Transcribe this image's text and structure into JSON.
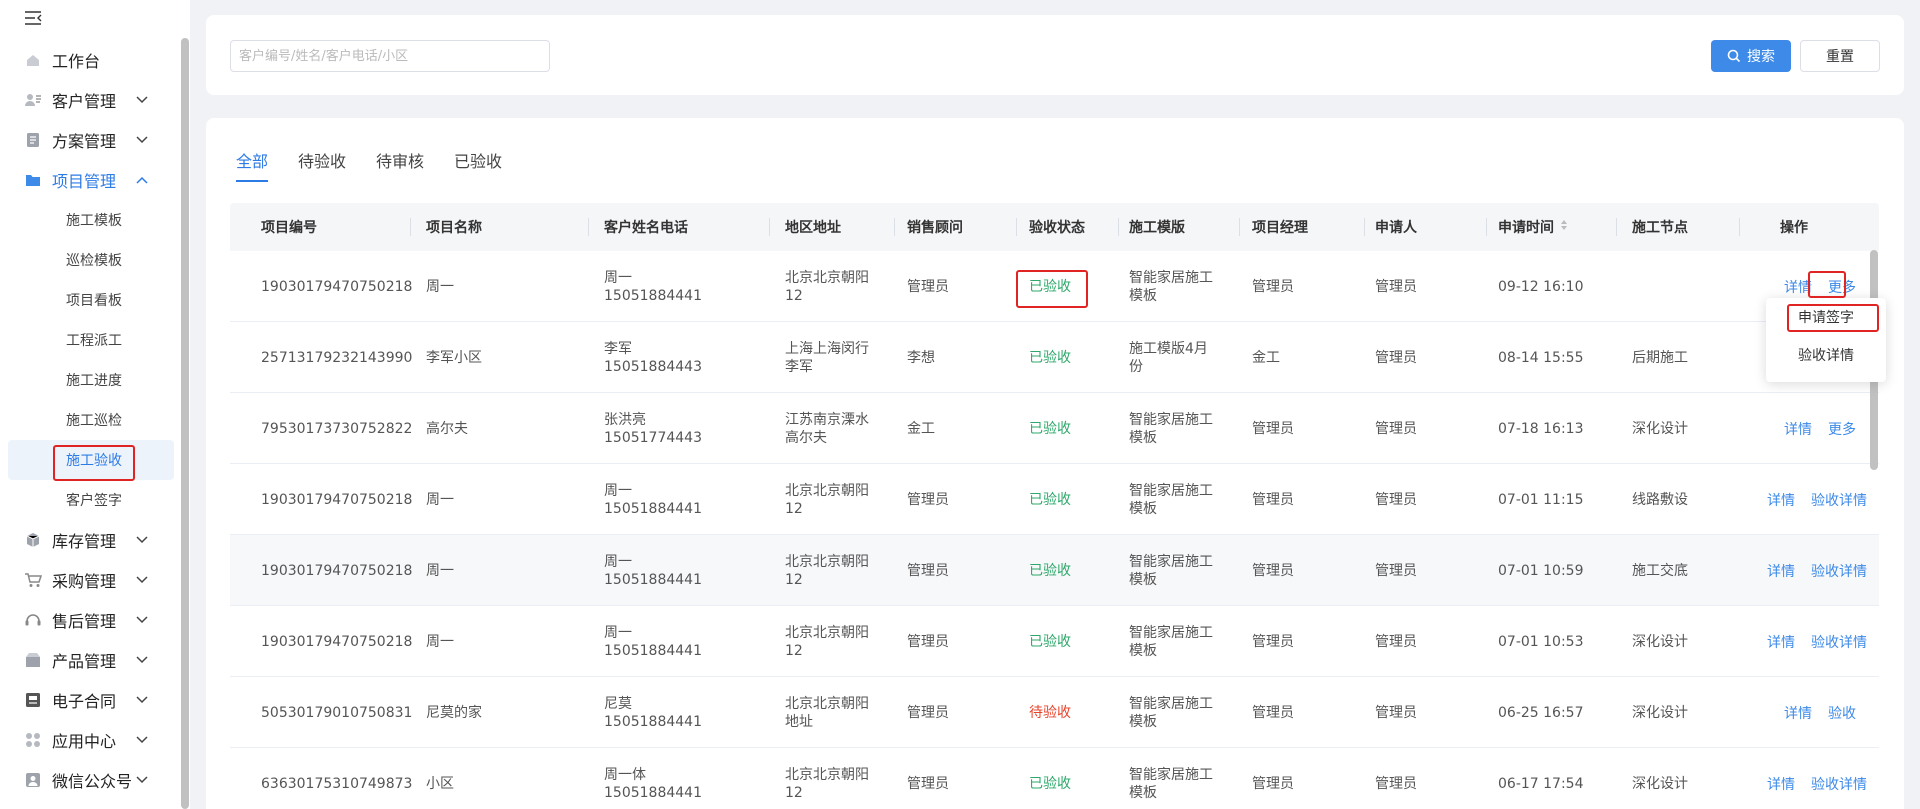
{
  "sidebar": {
    "items": [
      {
        "label": "工作台",
        "icon": "home-icon"
      },
      {
        "label": "客户管理",
        "icon": "customer-icon"
      },
      {
        "label": "方案管理",
        "icon": "plan-icon"
      },
      {
        "label": "项目管理",
        "icon": "folder-icon",
        "open": true
      },
      {
        "label": "库存管理",
        "icon": "inventory-icon"
      },
      {
        "label": "采购管理",
        "icon": "cart-icon"
      },
      {
        "label": "售后管理",
        "icon": "headset-icon"
      },
      {
        "label": "产品管理",
        "icon": "product-icon"
      },
      {
        "label": "电子合同",
        "icon": "contract-icon"
      },
      {
        "label": "应用中心",
        "icon": "apps-icon"
      },
      {
        "label": "微信公众号",
        "icon": "user-icon"
      }
    ],
    "sub_items": [
      "施工模板",
      "巡检模板",
      "项目看板",
      "工程派工",
      "施工进度",
      "施工巡检",
      "施工验收",
      "客户签字"
    ]
  },
  "search": {
    "placeholder": "客户编号/姓名/客户电话/小区",
    "search_label": "搜索",
    "reset_label": "重置"
  },
  "tabs": [
    "全部",
    "待验收",
    "待审核",
    "已验收"
  ],
  "table": {
    "headers": [
      "项目编号",
      "项目名称",
      "客户姓名电话",
      "地区地址",
      "销售顾问",
      "验收状态",
      "施工模版",
      "项目经理",
      "申请人",
      "申请时间",
      "施工节点",
      "操作"
    ],
    "rows": [
      {
        "id": "19030179470750218",
        "name": "周一",
        "cust": "周一",
        "phone": "15051884441",
        "addr1": "北京北京朝阳",
        "addr2": "12",
        "sales": "管理员",
        "status": "已验收",
        "tpl1": "智能家居施工",
        "tpl2": "模板",
        "pm": "管理员",
        "applicant": "管理员",
        "time": "09-12 16:10",
        "node": "",
        "op1": "详情",
        "op2": "更多"
      },
      {
        "id": "25713179232143990",
        "name": "李军小区",
        "cust": "李军",
        "phone": "15051884443",
        "addr1": "上海上海闵行",
        "addr2": "李军",
        "sales": "李想",
        "status": "已验收",
        "tpl1": "施工模版4月",
        "tpl2": "份",
        "pm": "金工",
        "applicant": "管理员",
        "time": "08-14 15:55",
        "node": "后期施工",
        "op1": "",
        "op2": ""
      },
      {
        "id": "79530173730752822",
        "name": "高尔夫",
        "cust": "张洪亮",
        "phone": "15051774443",
        "addr1": "江苏南京溧水",
        "addr2": "高尔夫",
        "sales": "金工",
        "status": "已验收",
        "tpl1": "智能家居施工",
        "tpl2": "模板",
        "pm": "管理员",
        "applicant": "管理员",
        "time": "07-18 16:13",
        "node": "深化设计",
        "op1": "详情",
        "op2": "更多"
      },
      {
        "id": "19030179470750218",
        "name": "周一",
        "cust": "周一",
        "phone": "15051884441",
        "addr1": "北京北京朝阳",
        "addr2": "12",
        "sales": "管理员",
        "status": "已验收",
        "tpl1": "智能家居施工",
        "tpl2": "模板",
        "pm": "管理员",
        "applicant": "管理员",
        "time": "07-01 11:15",
        "node": "线路敷设",
        "op1": "详情",
        "op2": "验收详情"
      },
      {
        "id": "19030179470750218",
        "name": "周一",
        "cust": "周一",
        "phone": "15051884441",
        "addr1": "北京北京朝阳",
        "addr2": "12",
        "sales": "管理员",
        "status": "已验收",
        "tpl1": "智能家居施工",
        "tpl2": "模板",
        "pm": "管理员",
        "applicant": "管理员",
        "time": "07-01 10:59",
        "node": "施工交底",
        "op1": "详情",
        "op2": "验收详情"
      },
      {
        "id": "19030179470750218",
        "name": "周一",
        "cust": "周一",
        "phone": "15051884441",
        "addr1": "北京北京朝阳",
        "addr2": "12",
        "sales": "管理员",
        "status": "已验收",
        "tpl1": "智能家居施工",
        "tpl2": "模板",
        "pm": "管理员",
        "applicant": "管理员",
        "time": "07-01 10:53",
        "node": "深化设计",
        "op1": "详情",
        "op2": "验收详情"
      },
      {
        "id": "50530179010750831",
        "name": "尼莫的家",
        "cust": "尼莫",
        "phone": "15051884441",
        "addr1": "北京北京朝阳",
        "addr2": "地址",
        "sales": "管理员",
        "status": "待验收",
        "tpl1": "智能家居施工",
        "tpl2": "模板",
        "pm": "管理员",
        "applicant": "管理员",
        "time": "06-25 16:57",
        "node": "深化设计",
        "op1": "详情",
        "op2": "验收"
      },
      {
        "id": "63630175310749873",
        "name": "小区",
        "cust": "周一体",
        "phone": "15051884441",
        "addr1": "北京北京朝阳",
        "addr2": "12",
        "sales": "管理员",
        "status": "已验收",
        "tpl1": "智能家居施工",
        "tpl2": "模板",
        "pm": "管理员",
        "applicant": "管理员",
        "time": "06-17 17:54",
        "node": "深化设计",
        "op1": "详情",
        "op2": "验收详情"
      }
    ]
  },
  "dropdown": {
    "items": [
      "申请签字",
      "验收详情"
    ]
  },
  "colors": {
    "accent": "#3d8ae8",
    "status_ok": "#2ea86b",
    "status_pending": "#e8432c",
    "highlight": "#e02424"
  }
}
